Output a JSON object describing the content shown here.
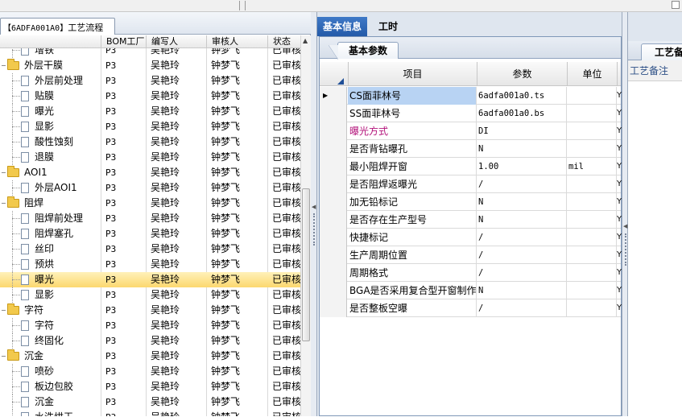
{
  "left": {
    "tab_code": "【6ADFA001A0】",
    "tab_label": "工艺流程",
    "columns": [
      "BOM工厂",
      "编写人",
      "审核人",
      "状态"
    ],
    "rows": [
      {
        "name": "增铁",
        "kind": "leaf",
        "indent": 1,
        "bom": "P3",
        "writer": "吴艳玲",
        "reviewer": "钟梦飞",
        "state": "已审核"
      },
      {
        "name": "外层干膜",
        "kind": "folder",
        "indent": 0,
        "bom": "P3",
        "writer": "吴艳玲",
        "reviewer": "钟梦飞",
        "state": "已审核"
      },
      {
        "name": "外层前处理",
        "kind": "leaf",
        "indent": 1,
        "bom": "P3",
        "writer": "吴艳玲",
        "reviewer": "钟梦飞",
        "state": "已审核"
      },
      {
        "name": "贴膜",
        "kind": "leaf",
        "indent": 1,
        "bom": "P3",
        "writer": "吴艳玲",
        "reviewer": "钟梦飞",
        "state": "已审核"
      },
      {
        "name": "曝光",
        "kind": "leaf",
        "indent": 1,
        "bom": "P3",
        "writer": "吴艳玲",
        "reviewer": "钟梦飞",
        "state": "已审核"
      },
      {
        "name": "显影",
        "kind": "leaf",
        "indent": 1,
        "bom": "P3",
        "writer": "吴艳玲",
        "reviewer": "钟梦飞",
        "state": "已审核"
      },
      {
        "name": "酸性蚀刻",
        "kind": "leaf",
        "indent": 1,
        "bom": "P3",
        "writer": "吴艳玲",
        "reviewer": "钟梦飞",
        "state": "已审核"
      },
      {
        "name": "退膜",
        "kind": "leaf",
        "indent": 1,
        "bom": "P3",
        "writer": "吴艳玲",
        "reviewer": "钟梦飞",
        "state": "已审核"
      },
      {
        "name": "AOI1",
        "kind": "folder",
        "indent": 0,
        "bom": "P3",
        "writer": "吴艳玲",
        "reviewer": "钟梦飞",
        "state": "已审核"
      },
      {
        "name": "外层AOI1",
        "kind": "leaf",
        "indent": 1,
        "bom": "P3",
        "writer": "吴艳玲",
        "reviewer": "钟梦飞",
        "state": "已审核"
      },
      {
        "name": "阻焊",
        "kind": "folder",
        "indent": 0,
        "bom": "P3",
        "writer": "吴艳玲",
        "reviewer": "钟梦飞",
        "state": "已审核"
      },
      {
        "name": "阻焊前处理",
        "kind": "leaf",
        "indent": 1,
        "bom": "P3",
        "writer": "吴艳玲",
        "reviewer": "钟梦飞",
        "state": "已审核"
      },
      {
        "name": "阻焊塞孔",
        "kind": "leaf",
        "indent": 1,
        "bom": "P3",
        "writer": "吴艳玲",
        "reviewer": "钟梦飞",
        "state": "已审核"
      },
      {
        "name": "丝印",
        "kind": "leaf",
        "indent": 1,
        "bom": "P3",
        "writer": "吴艳玲",
        "reviewer": "钟梦飞",
        "state": "已审核"
      },
      {
        "name": "预烘",
        "kind": "leaf",
        "indent": 1,
        "bom": "P3",
        "writer": "吴艳玲",
        "reviewer": "钟梦飞",
        "state": "已审核"
      },
      {
        "name": "曝光",
        "kind": "leaf",
        "indent": 1,
        "bom": "P3",
        "writer": "吴艳玲",
        "reviewer": "钟梦飞",
        "state": "已审核",
        "selected": true
      },
      {
        "name": "显影",
        "kind": "leaf",
        "indent": 1,
        "bom": "P3",
        "writer": "吴艳玲",
        "reviewer": "钟梦飞",
        "state": "已审核"
      },
      {
        "name": "字符",
        "kind": "folder",
        "indent": 0,
        "bom": "P3",
        "writer": "吴艳玲",
        "reviewer": "钟梦飞",
        "state": "已审核"
      },
      {
        "name": "字符",
        "kind": "leaf",
        "indent": 1,
        "bom": "P3",
        "writer": "吴艳玲",
        "reviewer": "钟梦飞",
        "state": "已审核"
      },
      {
        "name": "终固化",
        "kind": "leaf",
        "indent": 1,
        "bom": "P3",
        "writer": "吴艳玲",
        "reviewer": "钟梦飞",
        "state": "已审核"
      },
      {
        "name": "沉金",
        "kind": "folder",
        "indent": 0,
        "bom": "P3",
        "writer": "吴艳玲",
        "reviewer": "钟梦飞",
        "state": "已审核"
      },
      {
        "name": "喷砂",
        "kind": "leaf",
        "indent": 1,
        "bom": "P3",
        "writer": "吴艳玲",
        "reviewer": "钟梦飞",
        "state": "已审核"
      },
      {
        "name": "板边包胶",
        "kind": "leaf",
        "indent": 1,
        "bom": "P3",
        "writer": "吴艳玲",
        "reviewer": "钟梦飞",
        "state": "已审核"
      },
      {
        "name": "沉金",
        "kind": "leaf",
        "indent": 1,
        "bom": "P3",
        "writer": "吴艳玲",
        "reviewer": "钟梦飞",
        "state": "已审核"
      },
      {
        "name": "水洗烘干",
        "kind": "leaf",
        "indent": 1,
        "bom": "P3",
        "writer": "吴艳玲",
        "reviewer": "钟梦飞",
        "state": "已审核"
      }
    ]
  },
  "mid": {
    "tabs": [
      "基本信息",
      "工时"
    ],
    "sub_tab": "基本参数",
    "columns": {
      "item": "项目",
      "param": "参数",
      "unit": "单位"
    },
    "rows": [
      {
        "item": "CS面菲林号",
        "param": "6adfa001a0.ts",
        "unit": "",
        "extra": "Y"
      },
      {
        "item": "SS面菲林号",
        "param": "6adfa001a0.bs",
        "unit": "",
        "extra": "Y"
      },
      {
        "item": "曝光方式",
        "param": "DI",
        "unit": "",
        "extra": "Y",
        "highlight": true
      },
      {
        "item": "是否背钻曝孔",
        "param": "N",
        "unit": "",
        "extra": "Y"
      },
      {
        "item": "最小阻焊开窗",
        "param": "1.00",
        "unit": "mil",
        "extra": "Y"
      },
      {
        "item": "是否阻焊返曝光",
        "param": "/",
        "unit": "",
        "extra": "Y"
      },
      {
        "item": "加无铅标记",
        "param": "N",
        "unit": "",
        "extra": "Y"
      },
      {
        "item": "是否存在生产型号",
        "param": "N",
        "unit": "",
        "extra": "Y"
      },
      {
        "item": "快捷标记",
        "param": "/",
        "unit": "",
        "extra": "Y"
      },
      {
        "item": "生产周期位置",
        "param": "/",
        "unit": "",
        "extra": "Y"
      },
      {
        "item": "周期格式",
        "param": "/",
        "unit": "",
        "extra": "Y"
      },
      {
        "item": "BGA是否采用复合型开窗制作",
        "param": "N",
        "unit": "",
        "extra": "Y"
      },
      {
        "item": "是否整板空曝",
        "param": "/",
        "unit": "",
        "extra": "Y"
      }
    ]
  },
  "right": {
    "tab_label": "工艺备注",
    "head": "工艺备注"
  },
  "colors": {
    "accent": "#235aa8",
    "selected_row": "#fcd86f",
    "highlight_text": "#b3127a"
  }
}
